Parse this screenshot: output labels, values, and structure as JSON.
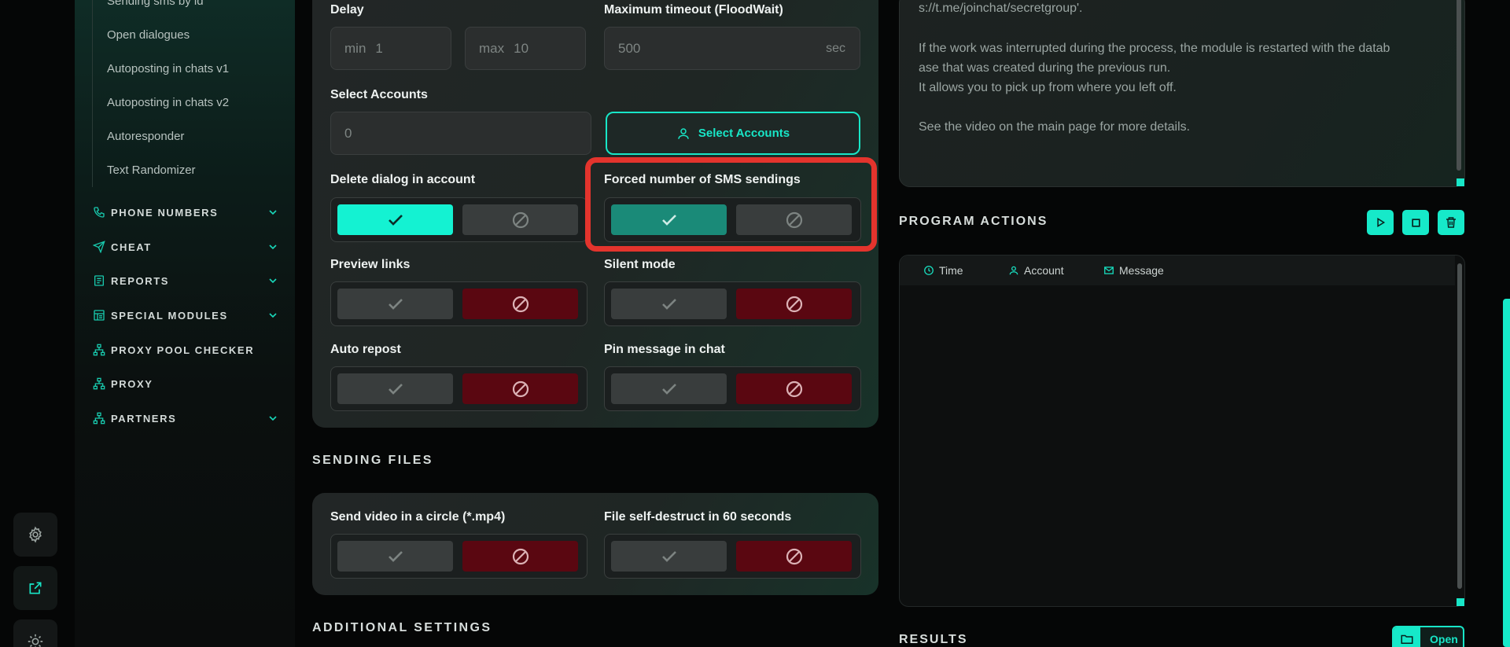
{
  "sidebar": {
    "sub_items": [
      "Sending sms by id",
      "Open dialogues",
      "Autoposting in chats v1",
      "Autoposting in chats v2",
      "Autoresponder",
      "Text Randomizer"
    ],
    "nav": [
      {
        "label": "PHONE NUMBERS",
        "icon": "phone-icon",
        "has_chevron": true
      },
      {
        "label": "CHEAT",
        "icon": "send-icon",
        "has_chevron": true
      },
      {
        "label": "REPORTS",
        "icon": "report-icon",
        "has_chevron": true
      },
      {
        "label": "SPECIAL MODULES",
        "icon": "modules-icon",
        "has_chevron": true
      },
      {
        "label": "PROXY POOL CHECKER",
        "icon": "network-icon",
        "has_chevron": false
      },
      {
        "label": "PROXY",
        "icon": "network-icon",
        "has_chevron": false
      },
      {
        "label": "PARTNERS",
        "icon": "network-icon",
        "has_chevron": true
      }
    ]
  },
  "settings": {
    "delay": {
      "label": "Delay",
      "min_prefix": "min",
      "min_value": "1",
      "max_prefix": "max",
      "max_value": "10"
    },
    "timeout": {
      "label": "Maximum timeout (FloodWait)",
      "value": "500",
      "unit": "sec"
    },
    "accounts": {
      "label": "Select Accounts",
      "count": "0",
      "button": "Select Accounts"
    },
    "toggles": [
      {
        "label": "Delete dialog in account",
        "state": "on"
      },
      {
        "label": "Forced number of SMS sendings",
        "state": "on",
        "highlighted": true
      },
      {
        "label": "Preview links",
        "state": "off"
      },
      {
        "label": "Silent mode",
        "state": "off"
      },
      {
        "label": "Auto repost",
        "state": "off"
      },
      {
        "label": "Pin message in chat",
        "state": "off"
      }
    ]
  },
  "sending_files": {
    "title": "SENDING FILES",
    "toggles": [
      {
        "label": "Send video in a circle (*.mp4)",
        "state": "off"
      },
      {
        "label": "File self-destruct in 60 seconds",
        "state": "off"
      }
    ]
  },
  "additional_settings": {
    "title": "ADDITIONAL SETTINGS"
  },
  "info": {
    "lines": [
      "s://t.me/joinchat/secretgroup'.",
      "If the work was interrupted during the process, the module is restarted with the datab",
      "ase that was created during the previous run.",
      "It allows you to pick up from where you left off.",
      "See the video on the main page for more details."
    ]
  },
  "program_actions": {
    "title": "PROGRAM ACTIONS",
    "columns": [
      "Time",
      "Account",
      "Message"
    ]
  },
  "results": {
    "title": "RESULTS",
    "open_label": "Open"
  },
  "colors": {
    "accent": "#18e6c7",
    "danger": "#5a0711",
    "highlight": "#e3342d"
  }
}
